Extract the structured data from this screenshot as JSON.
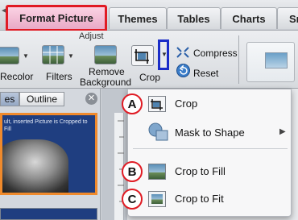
{
  "tabs": [
    {
      "label": "Format Picture"
    },
    {
      "label": "Themes"
    },
    {
      "label": "Tables"
    },
    {
      "label": "Charts"
    },
    {
      "label": "Sm"
    }
  ],
  "ribbon": {
    "group_label": "Adjust",
    "recolor": "Recolor",
    "filters": "Filters",
    "remove_bg_line1": "Remove",
    "remove_bg_line2": "Background",
    "crop": "Crop",
    "compress": "Compress",
    "reset": "Reset"
  },
  "pane": {
    "tab_slides": "es",
    "tab_outline": "Outline",
    "slide1_text": "ult, inserted Picture is Cropped to Fill"
  },
  "menu": {
    "items": [
      {
        "badge": "A",
        "label": "Crop"
      },
      {
        "badge": "",
        "label": "Mask to Shape"
      },
      {
        "badge": "B",
        "label": "Crop to Fill"
      },
      {
        "badge": "C",
        "label": "Crop to Fit"
      }
    ]
  },
  "colors": {
    "highlight_red": "#e01b24",
    "highlight_blue": "#1a2cc8",
    "slide_border_orange": "#f08a2c"
  }
}
